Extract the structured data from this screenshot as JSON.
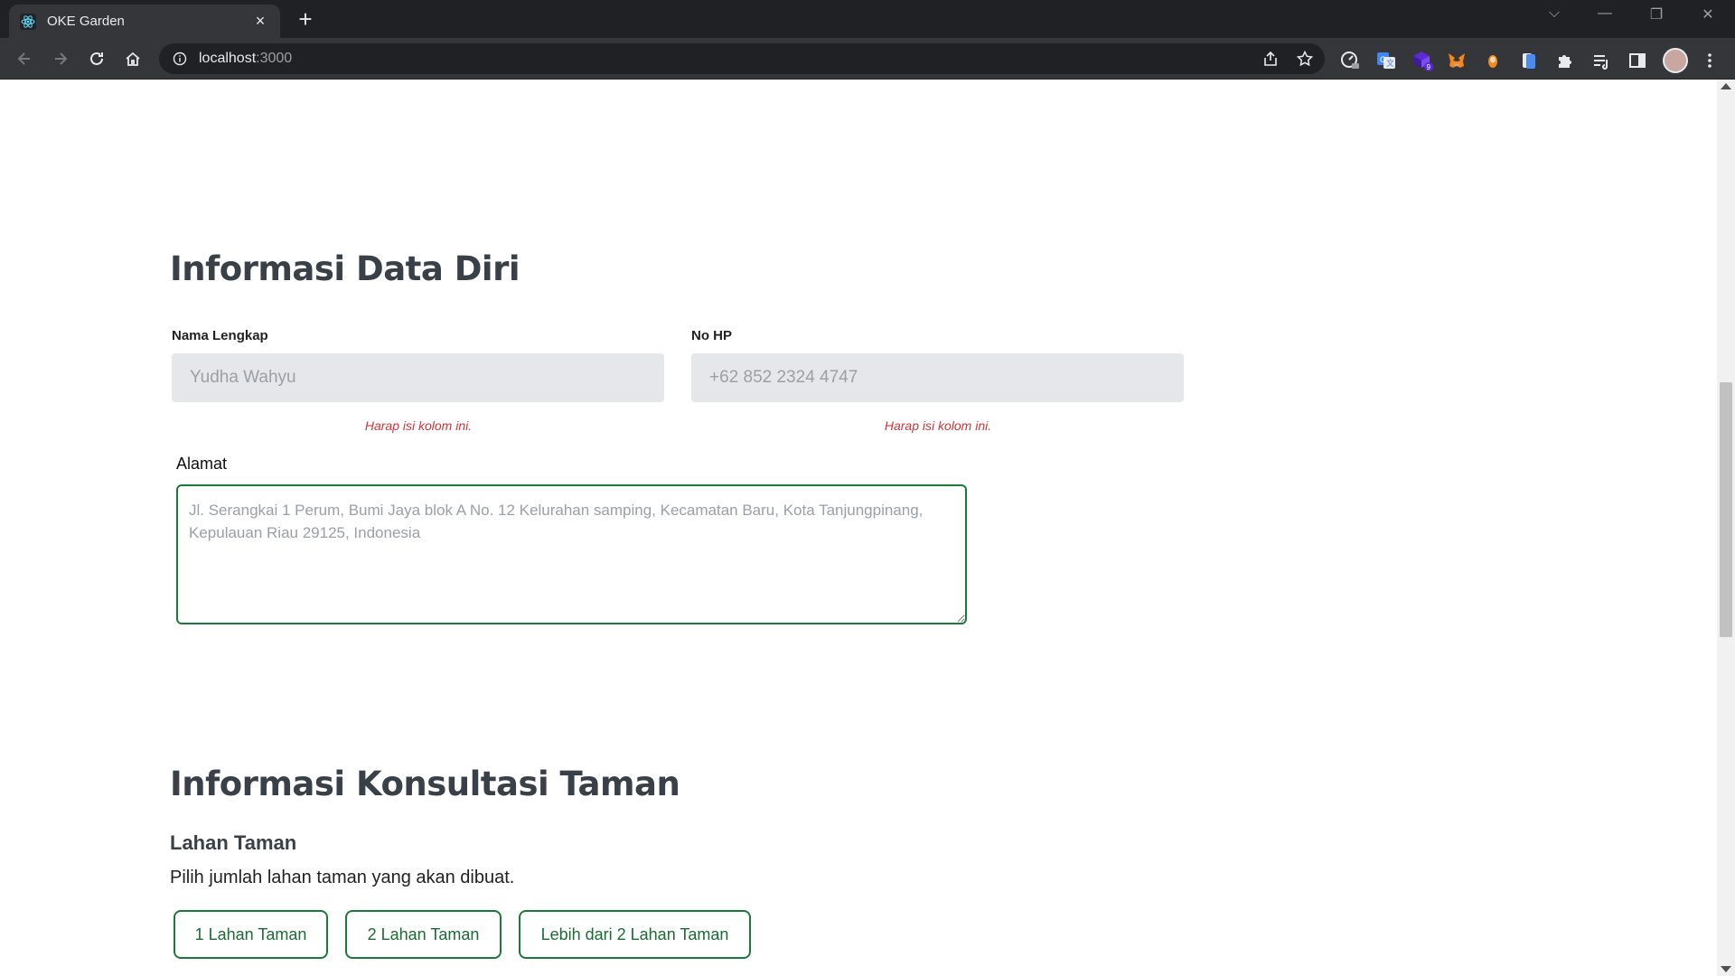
{
  "browser": {
    "tab_title": "OKE Garden",
    "tab_close": "×",
    "new_tab": "+",
    "url_host": "localhost",
    "url_port": ":3000",
    "window_controls": [
      "⌵",
      "—",
      "❐",
      "✕"
    ],
    "extensions": [
      "speed-dial",
      "google-translate",
      "extension-badge-9",
      "metamask",
      "extension-orange",
      "extension-blue",
      "puzzle-extensions",
      "reading-list",
      "side-panel"
    ],
    "extension_badge": "9"
  },
  "form": {
    "section1_title": "Informasi Data Diri",
    "name_label": "Nama Lengkap",
    "name_placeholder": "Yudha Wahyu",
    "phone_label": "No HP",
    "phone_placeholder": "+62 852 2324 4747",
    "error_text": "Harap isi kolom ini.",
    "address_label": "Alamat",
    "address_placeholder": "Jl. Serangkai 1 Perum, Bumi Jaya blok A No. 12 Kelurahan samping, Kecamatan Baru, Kota Tanjungpinang, Kepulauan Riau 29125, Indonesia",
    "section2_title": "Informasi Konsultasi Taman",
    "lahan_title": "Lahan Taman",
    "lahan_desc": "Pilih jumlah lahan taman yang akan dibuat.",
    "options": [
      "1 Lahan Taman",
      "2 Lahan Taman",
      "Lebih dari 2 Lahan Taman"
    ]
  },
  "colors": {
    "accent_green": "#1b7a3a",
    "error_red": "#d0353a",
    "heading": "#3a4048",
    "input_bg": "#e5e7eb"
  }
}
